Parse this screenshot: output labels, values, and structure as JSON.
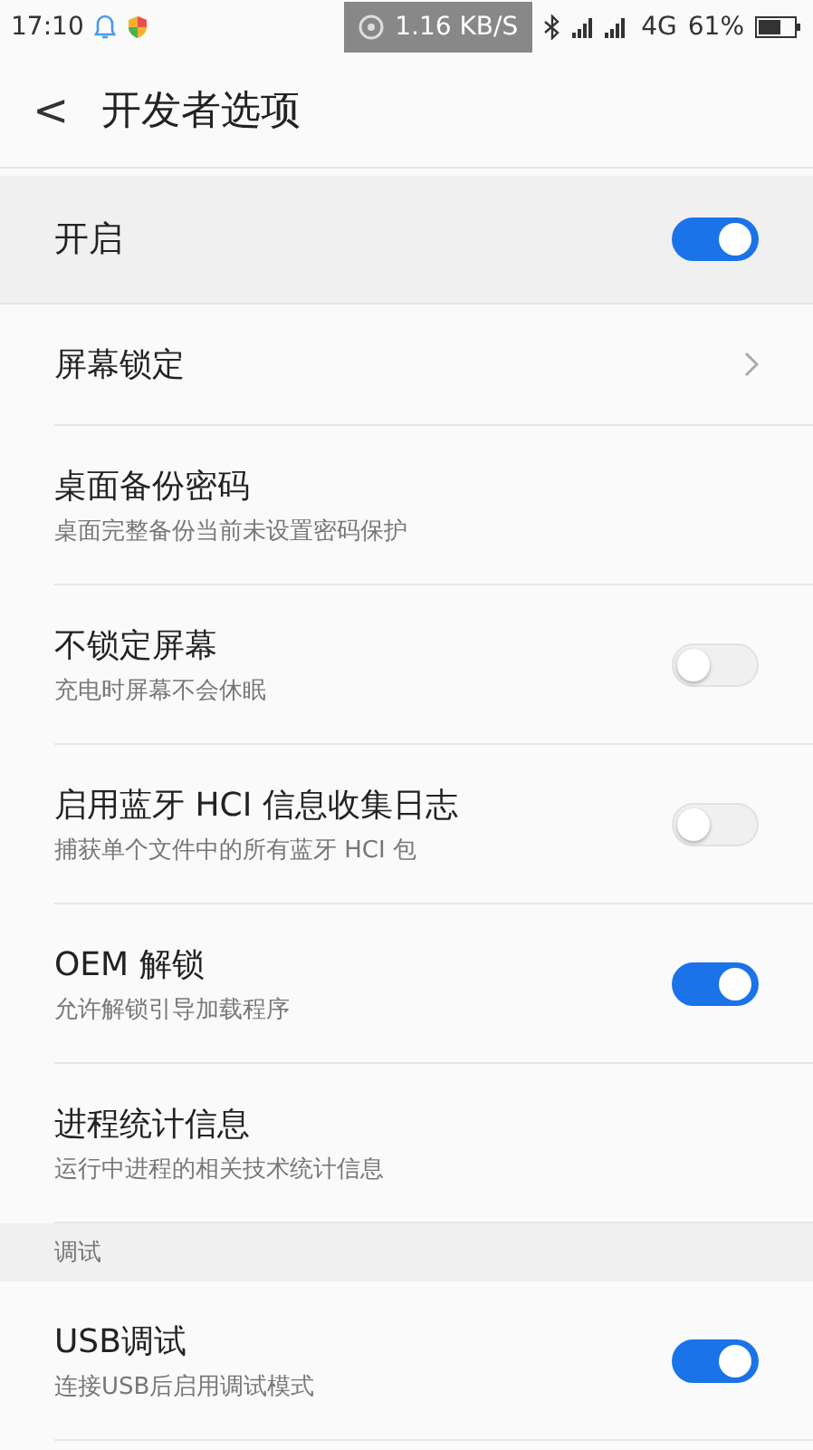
{
  "status_bar": {
    "time": "17:10",
    "speed": "1.16 KB/S",
    "network": "4G",
    "battery": "61%"
  },
  "header": {
    "back": "<",
    "title": "开发者选项"
  },
  "master": {
    "label": "开启",
    "on": true
  },
  "items": [
    {
      "kind": "chevron",
      "title": "屏幕锁定"
    },
    {
      "kind": "plain",
      "title": "桌面备份密码",
      "subtitle": "桌面完整备份当前未设置密码保护"
    },
    {
      "kind": "switch",
      "title": "不锁定屏幕",
      "subtitle": "充电时屏幕不会休眠",
      "on": false
    },
    {
      "kind": "switch",
      "title": "启用蓝牙 HCI 信息收集日志",
      "subtitle": "捕获单个文件中的所有蓝牙 HCI 包",
      "on": false
    },
    {
      "kind": "switch",
      "title": "OEM 解锁",
      "subtitle": "允许解锁引导加载程序",
      "on": true
    },
    {
      "kind": "plain",
      "title": "进程统计信息",
      "subtitle": "运行中进程的相关技术统计信息"
    }
  ],
  "section": {
    "title": "调试"
  },
  "items2": [
    {
      "kind": "switch",
      "title": "USB调试",
      "subtitle": "连接USB后启用调试模式",
      "on": true
    }
  ]
}
